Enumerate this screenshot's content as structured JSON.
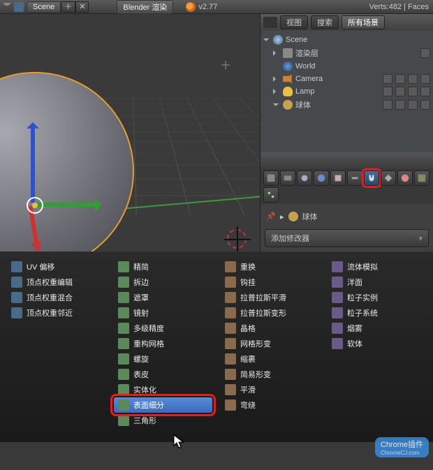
{
  "header": {
    "scene_label": "Scene",
    "plus": "＋",
    "x": "✕",
    "renderer": "Blender 渲染",
    "version": "v2.77",
    "stats": "Verts:482 | Faces"
  },
  "outliner_tabs": {
    "view": "视图",
    "search": "搜索",
    "all_scenes": "所有场景"
  },
  "outliner": {
    "scene": "Scene",
    "render_layers": "渲染层",
    "world": "World",
    "camera": "Camera",
    "lamp": "Lamp",
    "sphere": "球体"
  },
  "props": {
    "pin_object": "球体",
    "add_modifier": "添加修改器"
  },
  "modifier_menu": {
    "col1": [
      "UV 偏移",
      "顶点权重编辑",
      "顶点权重混合",
      "顶点权重邻近"
    ],
    "col2": [
      "精简",
      "拆边",
      "遮罩",
      "镜射",
      "多级精度",
      "重构网格",
      "螺旋",
      "表皮",
      "实体化",
      "表面细分",
      "三角形"
    ],
    "col3": [
      "重换",
      "钩挂",
      "拉普拉斯平滑",
      "拉普拉斯变形",
      "晶格",
      "网格形变",
      "缩裹",
      "简易形变",
      "平滑",
      "弯绕"
    ],
    "col4": [
      "流体模拟",
      "洋面",
      "粒子实例",
      "粒子系统",
      "烟雾",
      "软体"
    ]
  },
  "watermark": {
    "text": "Chrome插件",
    "url": "ChromeCJ.com"
  }
}
